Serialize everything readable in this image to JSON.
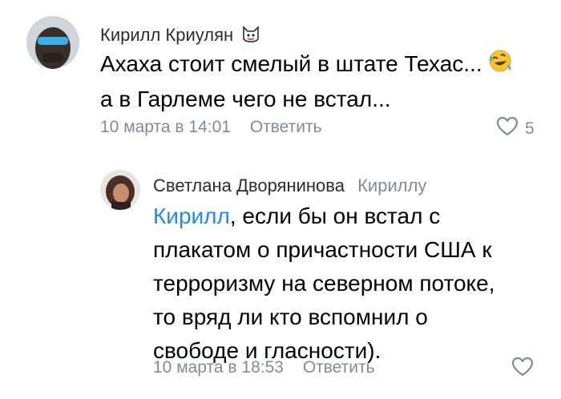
{
  "comments": [
    {
      "author": "Кирилл Криулян",
      "author_badge_icon": "cat-face-badge-icon",
      "text_line1": "Ахаха стоит смелый в штате Техас...",
      "text_emoji_icon": "rolling-on-floor-laughing-emoji-icon",
      "text_line2": "а в Гарлеме чего не встал...",
      "date": "10 марта в 14:01",
      "reply_label": "Ответить",
      "likes": "5"
    },
    {
      "author": "Светлана Дворянинова",
      "reply_to": "Кириллу",
      "mention": "Кирилл",
      "text_line1_rest": ", если бы он встал с",
      "text_line2": "плакатом о причастности США к",
      "text_line3": "терроризму на северном потоке,",
      "text_line4": "то вряд ли кто вспомнил о",
      "text_line5": "свободе и гласности).",
      "date": "10 марта в 18:53",
      "reply_label": "Ответить"
    }
  ],
  "colors": {
    "text": "#000000",
    "author": "#2c2d2e",
    "secondary": "#818c99",
    "mention": "#2688eb"
  }
}
